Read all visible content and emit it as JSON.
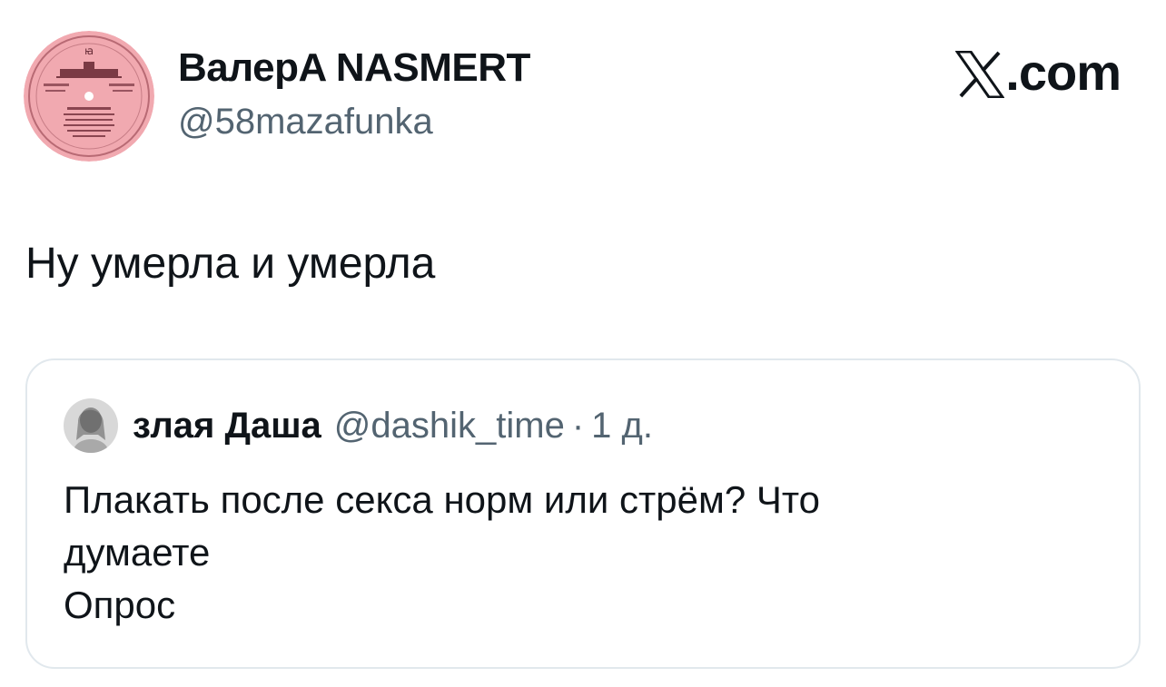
{
  "author": {
    "display_name": "ВалерA NASMERT",
    "handle": "@58mazafunka"
  },
  "brand": {
    "suffix": ".com"
  },
  "tweet": {
    "text": "Ну умерла и умерла"
  },
  "quoted": {
    "display_name": "злая Даша",
    "handle": "@dashik_time",
    "separator": "·",
    "time": "1 д.",
    "lines": [
      "Плакать после секса норм или стрём?  Что",
      "думаете",
      "Опрос"
    ]
  }
}
